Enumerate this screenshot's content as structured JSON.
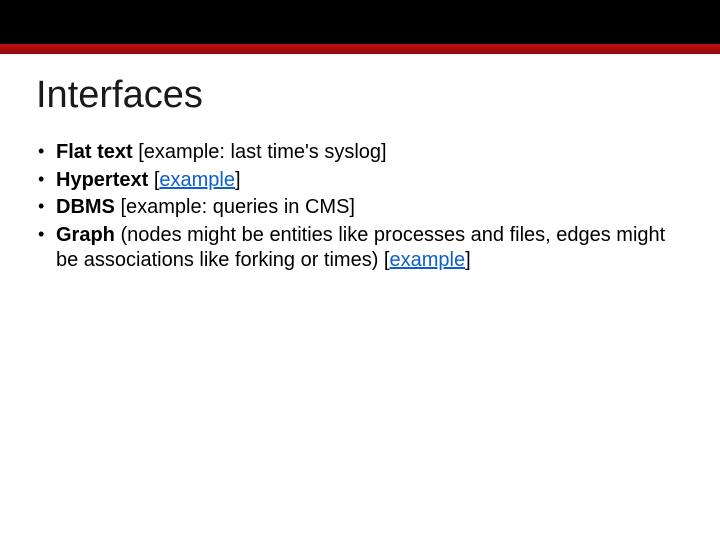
{
  "title": "Interfaces",
  "bullets": [
    {
      "label": "Flat text",
      "tail_before": " [example: last time's syslog]"
    },
    {
      "label": "Hypertext",
      "tail_before": " [",
      "link": "example",
      "tail_after": "]"
    },
    {
      "label": "DBMS",
      "tail_before": " [example: queries in CMS]"
    },
    {
      "label": "Graph",
      "tail_before": " (nodes might be entities like processes and files, edges might be associations like forking or times) [",
      "link": "example",
      "tail_after": "]"
    }
  ]
}
